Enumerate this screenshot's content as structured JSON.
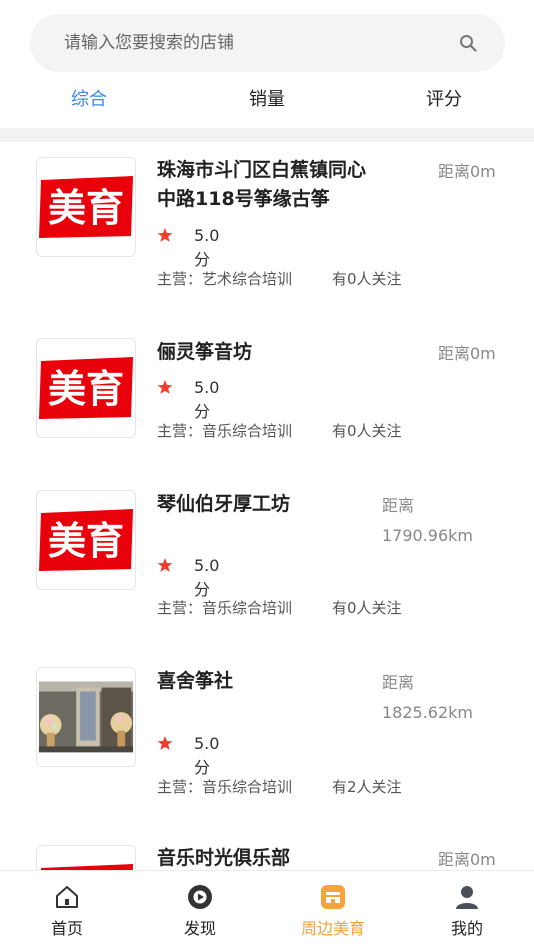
{
  "search": {
    "placeholder": "请输入您要搜索的店铺"
  },
  "tabs": [
    {
      "label": "综合",
      "active": true
    },
    {
      "label": "销量",
      "active": false
    },
    {
      "label": "评分",
      "active": false
    }
  ],
  "shops": [
    {
      "name_line1": "珠海市斗门区白蕉镇同心",
      "name_line2": "中路118号筝缘古筝",
      "distance": "距离0m",
      "distance_label": "",
      "distance_value": "",
      "rating": "5.0分",
      "main": "主营：艺术综合培训",
      "followers": "有0人关注",
      "thumb": "meiyu-logo"
    },
    {
      "name_line1": "俪灵筝音坊",
      "name_line2": "",
      "distance": "距离0m",
      "distance_label": "",
      "distance_value": "",
      "rating": "5.0分",
      "main": "主营：音乐综合培训",
      "followers": "有0人关注",
      "thumb": "meiyu-logo"
    },
    {
      "name_line1": "琴仙伯牙厚工坊",
      "name_line2": "",
      "distance": "",
      "distance_label": "距离",
      "distance_value": "1790.96km",
      "rating": "5.0分",
      "main": "主营：音乐综合培训",
      "followers": "有0人关注",
      "thumb": "meiyu-logo"
    },
    {
      "name_line1": "喜舍筝社",
      "name_line2": "",
      "distance": "",
      "distance_label": "距离",
      "distance_value": "1825.62km",
      "rating": "5.0分",
      "main": "主营：音乐综合培训",
      "followers": "有2人关注",
      "thumb": "shop-photo"
    },
    {
      "name_line1": "音乐时光俱乐部",
      "name_line2": "",
      "distance": "距离0m",
      "distance_label": "",
      "distance_value": "",
      "rating": "",
      "main": "",
      "followers": "",
      "thumb": "meiyu-logo"
    }
  ],
  "logo_text": "美育",
  "bottom_nav": [
    {
      "label": "首页",
      "icon": "home-icon",
      "active": false
    },
    {
      "label": "发现",
      "icon": "discover-icon",
      "active": false
    },
    {
      "label": "周边美育",
      "icon": "nearby-store-icon",
      "active": true
    },
    {
      "label": "我的",
      "icon": "user-icon",
      "active": false
    }
  ],
  "colors": {
    "accent_blue": "#3f86f0",
    "star_red": "#f23c2c",
    "logo_red": "#e8000b",
    "active_orange": "#f5a33a"
  }
}
